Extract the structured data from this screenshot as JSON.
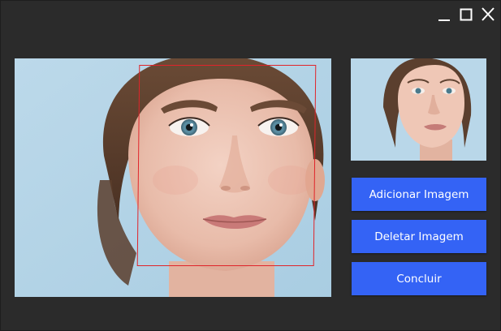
{
  "window": {
    "controls": {
      "minimize_icon": "minimize-icon",
      "maximize_icon": "maximize-icon",
      "close_icon": "close-icon"
    }
  },
  "colors": {
    "background": "#2b2b2b",
    "button": "#3463f5",
    "button_text": "#ffffff",
    "face_box": "#e0242a",
    "photo_bg": "#c3dcec"
  },
  "actions": {
    "add_label": "Adicionar Imagem",
    "delete_label": "Deletar Imagem",
    "done_label": "Concluir"
  }
}
